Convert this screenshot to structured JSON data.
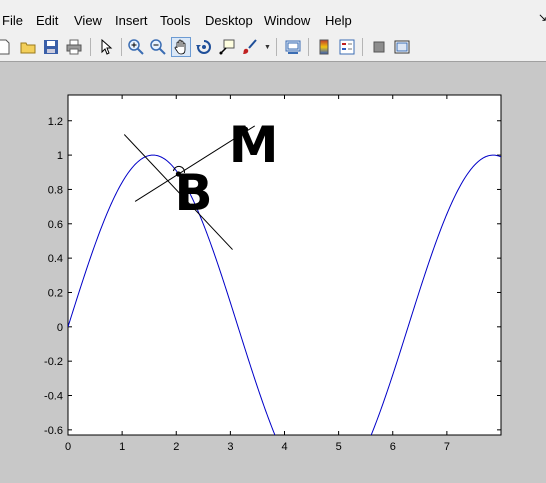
{
  "menubar": {
    "items": [
      "File",
      "Edit",
      "View",
      "Insert",
      "Tools",
      "Desktop",
      "Window",
      "Help"
    ]
  },
  "toolbar": {
    "buttons": [
      "new-figure",
      "open-file",
      "save",
      "print",
      "edit-plot",
      "zoom-in",
      "zoom-out",
      "pan",
      "rotate-3d",
      "data-cursor",
      "brush",
      "link-plot",
      "colorbar",
      "legend",
      "hide-plot-tools",
      "show-plot-tools"
    ],
    "active": "pan"
  },
  "colors": {
    "curve": "#0000c8",
    "figure_background": "#c8c8c8",
    "axes_background": "#ffffff"
  },
  "chart_data": {
    "type": "line",
    "title": "",
    "xlabel": "",
    "ylabel": "",
    "xlim": [
      0,
      8
    ],
    "ylim": [
      -0.63,
      1.35
    ],
    "xticks": [
      "0",
      "1",
      "2",
      "3",
      "4",
      "5",
      "6",
      "7"
    ],
    "yticks": [
      "-0.6",
      "-0.4",
      "-0.2",
      "0",
      "0.2",
      "0.4",
      "0.6",
      "0.8",
      "1",
      "1.2"
    ],
    "series": [
      {
        "function": "sin(x)",
        "x_range": [
          0,
          8
        ]
      }
    ],
    "lines": [
      {
        "label": "tangent",
        "x": [
          1.04,
          3.04
        ],
        "y": [
          1.12,
          0.45
        ]
      },
      {
        "label": "normal",
        "x": [
          1.24,
          3.45
        ],
        "y": [
          0.73,
          1.17
        ]
      }
    ],
    "points": [
      {
        "x": 2.04,
        "y": 0.89
      },
      {
        "x": 3.28,
        "y": 1.15
      }
    ],
    "annotations": [
      {
        "text": "B",
        "x": 2.32,
        "y": 0.68
      },
      {
        "text": "M",
        "x": 3.43,
        "y": 0.96
      }
    ],
    "grid": false
  }
}
